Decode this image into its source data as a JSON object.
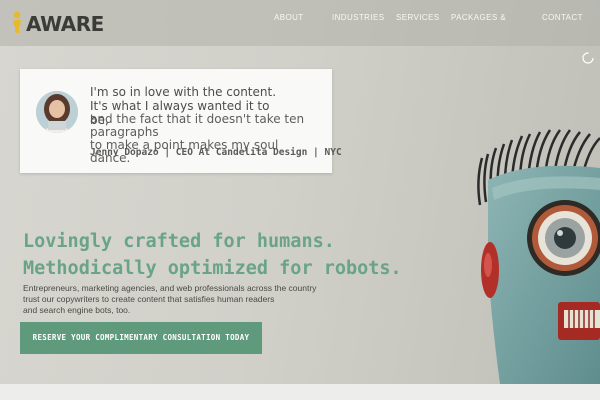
{
  "brand": {
    "name": "AWARE"
  },
  "nav": {
    "items": [
      {
        "label": "ABOUT"
      },
      {
        "label": "INDUSTRIES"
      },
      {
        "label": "SERVICES"
      },
      {
        "label": "PACKAGES &"
      },
      {
        "label": "CONTACT"
      }
    ]
  },
  "testimonial": {
    "quote_lines": [
      "I'm so in love with the content.",
      "It's what I always wanted it to",
      "be,"
    ],
    "quote_overlap_lines": [
      "and the fact that it doesn't take ten",
      "paragraphs",
      "to make a point makes my soul",
      "dance."
    ],
    "attribution": "Jenny Dopazo | CEO At Candelita Design | NYC"
  },
  "hero": {
    "headline_lines": [
      "Lovingly crafted for humans.",
      "Methodically optimized for robots."
    ],
    "subtext_lines": [
      "Entrepreneurs, marketing agencies, and web professionals across the country",
      "trust our copywriters to create content that satisfies human readers",
      "and search engine bots, too."
    ],
    "cta_label": "RESERVE YOUR COMPLIMENTARY CONSULTATION TODAY"
  },
  "icons": {
    "logo_figure": "person-figure-icon",
    "loader": "spinner-icon"
  },
  "colors": {
    "accent_green": "#6aa486",
    "button_green": "#5f9a7c",
    "logo_yellow": "#e8b92a",
    "robot_teal": "#7fa8a8",
    "robot_red": "#b8322c"
  }
}
